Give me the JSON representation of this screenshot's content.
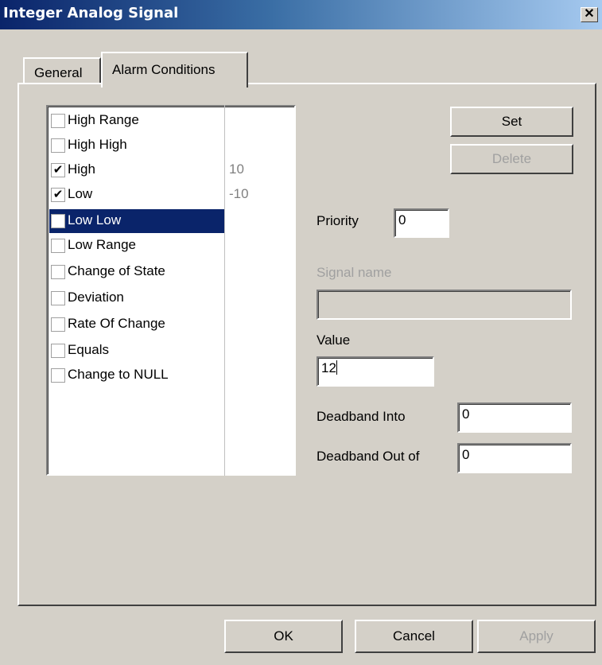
{
  "window": {
    "title": "Integer Analog Signal",
    "close_glyph": "✕"
  },
  "tabs": [
    {
      "label": "General",
      "active": false
    },
    {
      "label": "Alarm Conditions",
      "active": true
    }
  ],
  "conditions": [
    {
      "label": "High Range",
      "checked": false,
      "value": ""
    },
    {
      "label": "High High",
      "checked": false,
      "value": ""
    },
    {
      "label": "High",
      "checked": true,
      "check_glyph": "✔",
      "value": "10"
    },
    {
      "label": "Low",
      "checked": true,
      "check_glyph": "✔",
      "value": "-10"
    },
    {
      "label": "Low Low",
      "checked": false,
      "selected": true,
      "value": ""
    },
    {
      "label": "Low Range",
      "checked": false,
      "value": ""
    },
    {
      "label": "Change of State",
      "checked": false,
      "value": ""
    },
    {
      "label": "Deviation",
      "checked": false,
      "value": ""
    },
    {
      "label": "Rate Of Change",
      "checked": false,
      "value": ""
    },
    {
      "label": "Equals",
      "checked": false,
      "value": ""
    },
    {
      "label": "Change to NULL",
      "checked": false,
      "value": ""
    }
  ],
  "buttons": {
    "set": "Set",
    "delete": "Delete",
    "ok": "OK",
    "cancel": "Cancel",
    "apply": "Apply"
  },
  "form": {
    "priority_label": "Priority",
    "priority_value": "0",
    "signal_name_label": "Signal name",
    "signal_name_value": "",
    "value_label": "Value",
    "value_value": "12",
    "deadband_into_label": "Deadband Into",
    "deadband_into_value": "0",
    "deadband_out_label": "Deadband Out of",
    "deadband_out_value": "0"
  },
  "colors": {
    "selection": "#0a246a",
    "face": "#d4d0c8",
    "disabled_text": "#a0a0a0"
  }
}
